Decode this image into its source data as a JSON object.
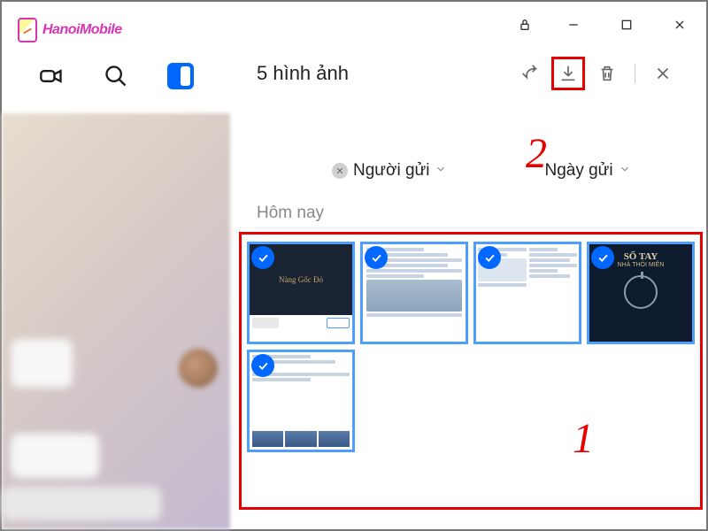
{
  "logo": {
    "text": "HanoiMobile"
  },
  "panel": {
    "title": "5 hình ảnh"
  },
  "filters": {
    "sender": "Người gửi",
    "date": "Ngày gửi"
  },
  "section": {
    "today": "Hôm nay"
  },
  "annotations": {
    "step1": "1",
    "step2": "2"
  },
  "thumbs": {
    "t1_text": "Nàng\nGốc Đỏ",
    "t4_title": "SỔ TAY",
    "t4_sub": "NHÀ THÔI MIÊN"
  }
}
